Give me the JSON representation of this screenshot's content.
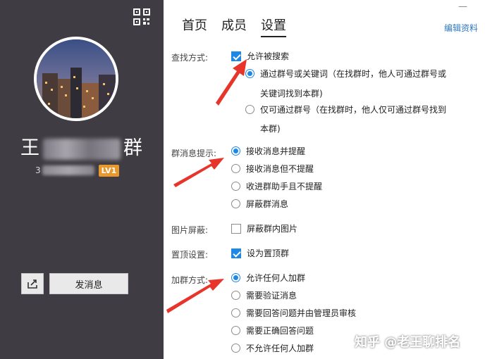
{
  "left_panel": {
    "group_name_start": "王",
    "group_name_end": "群",
    "group_id_prefix": "3",
    "level_badge": "LV1",
    "send_button": "发消息"
  },
  "header": {
    "tabs": [
      "首页",
      "成员",
      "设置"
    ],
    "edit_link": "编辑资料",
    "close": "—"
  },
  "settings": {
    "search": {
      "label": "查找方式:",
      "allow_search": "允许被搜索",
      "opt1_line1": "通过群号或关键词（在找群时，他人可通过群号或",
      "opt1_line2": "关键词找到本群)",
      "opt2_line1": "仅可通过群号（在找群时，他人仅可通过群号找到",
      "opt2_line2": "本群)"
    },
    "message": {
      "label": "群消息提示:",
      "options": [
        "接收消息并提醒",
        "接收消息但不提醒",
        "收进群助手且不提醒",
        "屏蔽群消息"
      ]
    },
    "image_block": {
      "label": "图片屏蔽:",
      "option": "屏蔽群内图片"
    },
    "pin": {
      "label": "置顶设置:",
      "option": "设为置顶群"
    },
    "join": {
      "label": "加群方式:",
      "options": [
        "允许任何人加群",
        "需要验证消息",
        "需要回答问题并由管理员审核",
        "需要正确回答问题",
        "不允许任何人加群"
      ]
    }
  },
  "watermark": "知乎 @老王聊排名",
  "colors": {
    "accent": "#1e88e5",
    "arrow": "#e8352b",
    "left_bg": "#3f3d43",
    "badge": "#e8992d"
  }
}
